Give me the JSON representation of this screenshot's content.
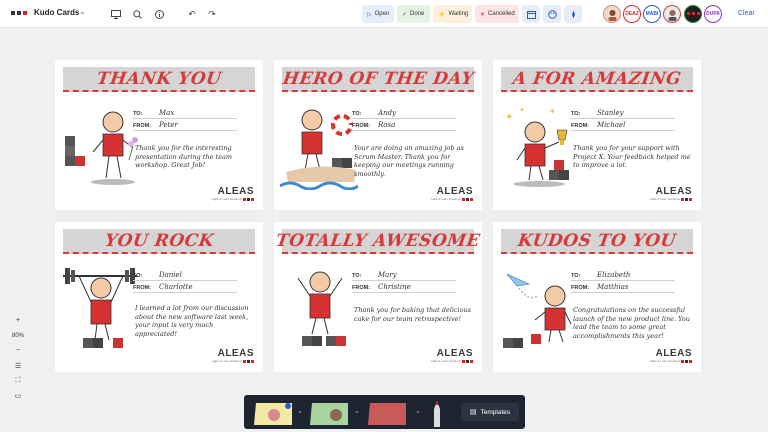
{
  "app": {
    "title": "Kudo Cards"
  },
  "status_filters": [
    {
      "label": "Open",
      "icon": "play-icon",
      "color": "#2a5bd7"
    },
    {
      "label": "Done",
      "icon": "check-icon",
      "color": "#2e8b3e"
    },
    {
      "label": "Waiting",
      "icon": "bolt-icon",
      "color": "#e59a1c"
    },
    {
      "label": "Cancelled",
      "icon": "x-icon",
      "color": "#d7262a"
    }
  ],
  "users": [
    {
      "initials": "",
      "color": "#d48a8a"
    },
    {
      "initials": "DEAZ",
      "color": "#d7262a"
    },
    {
      "initials": "MABI",
      "color": "#2a5bd7"
    },
    {
      "initials": "",
      "color": "#c44"
    },
    {
      "initials": "",
      "color": "#2e8b3e"
    },
    {
      "initials": "DUPA",
      "color": "#8e3bb5"
    }
  ],
  "toolbar": {
    "clear_label": "Clear",
    "templates_label": "Templates"
  },
  "zoom": {
    "level": "80%"
  },
  "cards": [
    {
      "heading": "Thank You",
      "to_label": "TO:",
      "from_label": "FROM:",
      "to": "Max",
      "from": "Peter",
      "message": "Thank you for the interesting presentation during the team workshop. Great Job!"
    },
    {
      "heading": "Hero of the Day",
      "to_label": "TO:",
      "from_label": "FROM:",
      "to": "Andy",
      "from": "Rosa",
      "message": "Your are doing an amazing job as Scrum Master. Thank you for keeping our meetings running smoothly."
    },
    {
      "heading": "A for Amazing",
      "to_label": "TO:",
      "from_label": "FROM:",
      "to": "Stanley",
      "from": "Michael",
      "message": "Thank you for your support with Project X. Your feedback helped me to improve a lot."
    },
    {
      "heading": "You Rock",
      "to_label": "TO:",
      "from_label": "FROM:",
      "to": "Daniel",
      "from": "Charlotte",
      "message": "I learned a lot from our discussion about the new software last week, your input is very much appreciated!"
    },
    {
      "heading": "Totally Awesome",
      "to_label": "TO:",
      "from_label": "FROM:",
      "to": "Mary",
      "from": "Christine",
      "message": "Thank you for baking that delicious cake for our team retrospective!"
    },
    {
      "heading": "Kudos to You",
      "to_label": "TO:",
      "from_label": "FROM:",
      "to": "Elizabeth",
      "from": "Matthias",
      "message": "Congratulations on the successful launch of the new product line. You lead the team to some great accomplishments this year!"
    }
  ],
  "brand": {
    "name": "ALEAS",
    "tagline": "Agile & Lean Solutions"
  }
}
